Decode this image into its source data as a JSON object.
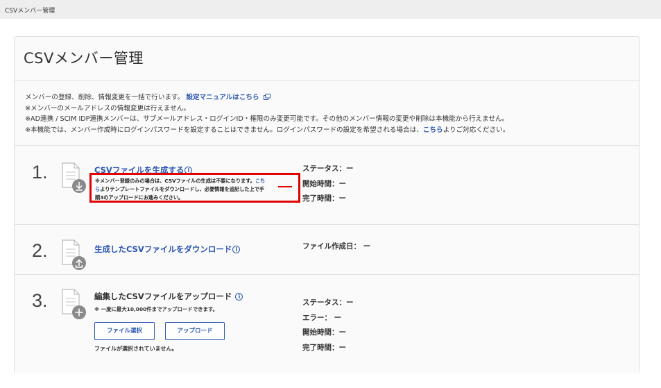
{
  "breadcrumb": "CSVメンバー管理",
  "page_title": "CSVメンバー管理",
  "notes": {
    "line1_text": "メンバーの登録、削除、情報変更を一括で行います。",
    "line1_link": "設定マニュアルはこちら",
    "line2": "※メンバーのメールアドレスの情報変更は行えません。",
    "line3": "※AD連携 / SCIM IDP連携メンバーは、サブメールアドレス・ログインID・権限のみ変更可能です。その他のメンバー情報の変更や削除は本機能から行えません。",
    "line4_text": "※本機能では、メンバー作成時にログインパスワードを設定することはできません。ログインパスワードの設定を希望される場合は、",
    "line4_link": "こちら",
    "line4_suffix": "よりご対応ください。"
  },
  "steps": [
    {
      "number": "1.",
      "title": "CSVファイルを生成する",
      "icon": "file-download-icon",
      "notice_line1": "※メンバー登録のみの場合は、CSVファイルの生成は不要になります。",
      "notice_link1": "こち",
      "notice_link2": "ら",
      "notice_line2": "よりテンプレートファイルをダウンロードし、必要情報を追記した上で手",
      "notice_line3": "順3のアップロードにお進みください。",
      "status": [
        "ステータス：ー",
        "開始時間：ー",
        "完了時間：ー"
      ]
    },
    {
      "number": "2.",
      "title": "生成したCSVファイルをダウンロード",
      "icon": "file-upload-icon",
      "status": [
        "ファイル作成日： ー"
      ]
    },
    {
      "number": "3.",
      "title": "編集したCSVファイルをアップロード",
      "icon": "file-add-icon",
      "sub_note": "※ 一度に最大10,000件までアップロードできます。",
      "select_button": "ファイル選択",
      "upload_button": "アップロード",
      "no_file": "ファイルが選択されていません。",
      "status": [
        "ステータス：ー",
        "エラー： ー",
        "開始時間：ー",
        "完了時間：ー"
      ]
    }
  ],
  "info_symbol": "i",
  "colors": {
    "link": "#2c56b1",
    "highlight": "#e00000"
  }
}
